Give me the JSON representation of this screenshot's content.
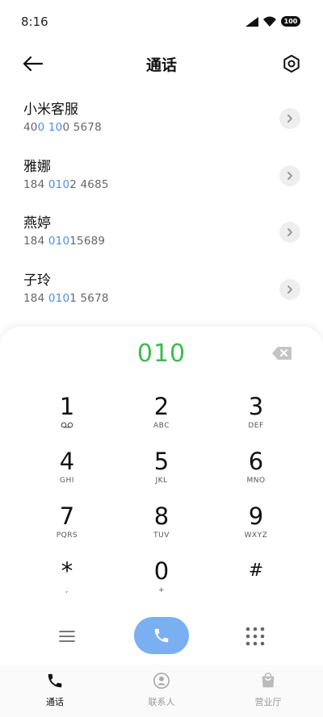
{
  "status_bar": {
    "time": "8:16",
    "battery": "100"
  },
  "header": {
    "title": "通话"
  },
  "results": [
    {
      "name": "小米客服",
      "number_parts": [
        "40",
        "0 10",
        "0 5678"
      ]
    },
    {
      "name": "雅娜",
      "number_parts": [
        "184 ",
        "010",
        "2 4685"
      ]
    },
    {
      "name": "燕婷",
      "number_parts": [
        "184 ",
        "010",
        "15689"
      ]
    },
    {
      "name": "子玲",
      "number_parts": [
        "184 ",
        "010",
        "1 5678"
      ]
    }
  ],
  "dialpad": {
    "input": "010",
    "keys": [
      {
        "digit": "1",
        "letters": ""
      },
      {
        "digit": "2",
        "letters": "ABC"
      },
      {
        "digit": "3",
        "letters": "DEF"
      },
      {
        "digit": "4",
        "letters": "GHI"
      },
      {
        "digit": "5",
        "letters": "JKL"
      },
      {
        "digit": "6",
        "letters": "MNO"
      },
      {
        "digit": "7",
        "letters": "PQRS"
      },
      {
        "digit": "8",
        "letters": "TUV"
      },
      {
        "digit": "9",
        "letters": "WXYZ"
      },
      {
        "digit": "*",
        "letters": ","
      },
      {
        "digit": "0",
        "letters": "+"
      },
      {
        "digit": "#",
        "letters": ""
      }
    ]
  },
  "bottom_nav": [
    {
      "label": "通话",
      "icon": "phone-icon",
      "active": true
    },
    {
      "label": "联系人",
      "icon": "contact-icon",
      "active": false
    },
    {
      "label": "营业厅",
      "icon": "shopping-bag-icon",
      "active": false
    }
  ],
  "colors": {
    "accent": "#4a90e2",
    "dial_input": "#3dbb4f",
    "call_button": "#7ab0f2"
  },
  "icons": {
    "back": "arrow-left-icon",
    "settings": "gear-icon",
    "backspace": "backspace-icon",
    "menu": "menu-icon",
    "call": "phone-icon",
    "keypad": "keypad-icon",
    "voicemail": "voicemail-icon"
  }
}
